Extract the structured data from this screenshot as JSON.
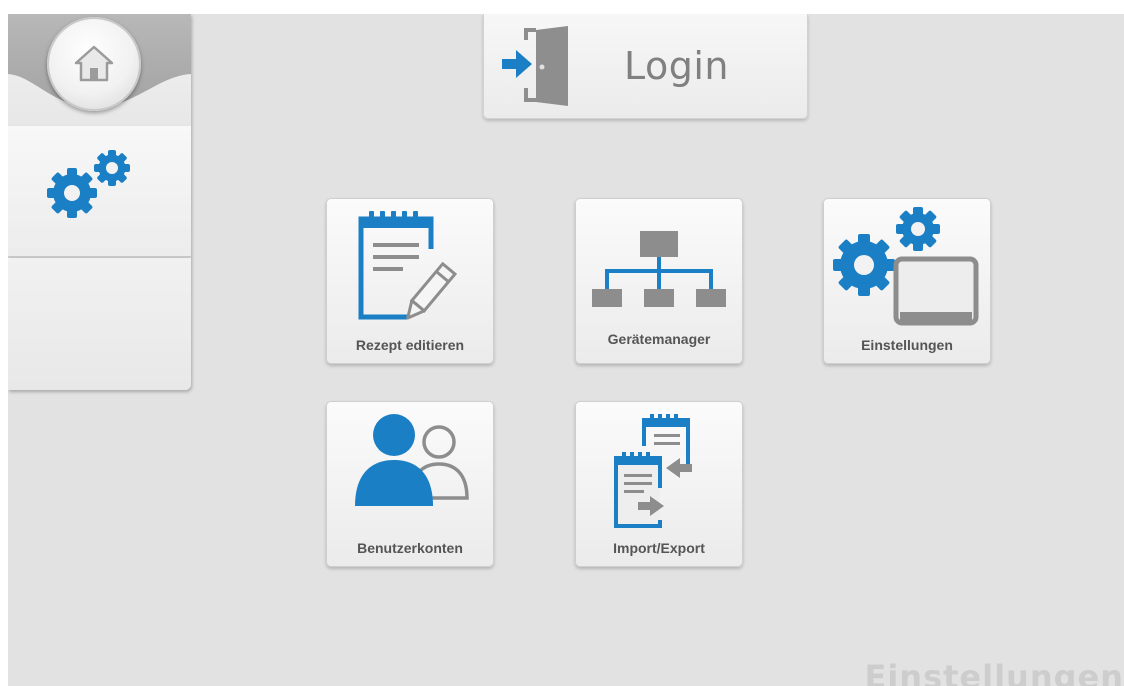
{
  "login": {
    "label": "Login"
  },
  "tiles": [
    {
      "label": "Rezept editieren",
      "icon": "recipe-edit-icon"
    },
    {
      "label": "Gerätemanager",
      "icon": "device-tree-icon"
    },
    {
      "label": "Einstellungen",
      "icon": "settings-tablet-icon"
    },
    {
      "label": "Benutzerkonten",
      "icon": "users-icon"
    },
    {
      "label": "Import/Export",
      "icon": "import-export-icon"
    }
  ],
  "sidebar": {
    "home_icon": "home-icon",
    "settings_icon": "gears-icon"
  },
  "page_watermark": "Einstellungen",
  "colors": {
    "accent": "#1a7fc4",
    "icon_gray": "#8d8d8d",
    "background": "#e2e2e2"
  }
}
